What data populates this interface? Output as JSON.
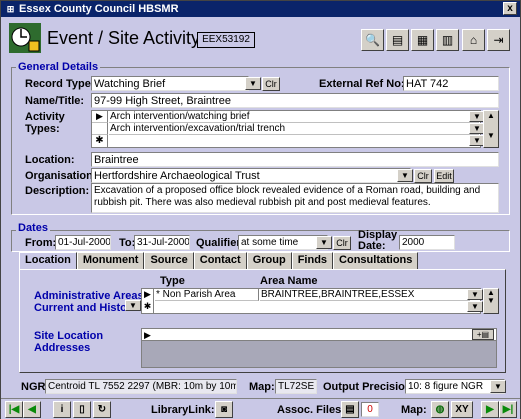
{
  "window": {
    "title": "Essex County Council HBSMR",
    "close": "x"
  },
  "header": {
    "form_title": "Event / Site Activity",
    "record_id": "EEX53192"
  },
  "general": {
    "legend": "General Details",
    "record_type_label": "Record Type:",
    "record_type_value": "Watching Brief",
    "ext_ref_label": "External Ref No:",
    "ext_ref_value": "HAT 742",
    "name_label": "Name/Title:",
    "name_value": "97-99 High Street, Braintree",
    "activity_label": "Activity Types:",
    "activity_types": [
      "Arch intervention/watching brief",
      "Arch intervention/excavation/trial trench"
    ],
    "location_label": "Location:",
    "location_value": "Braintree",
    "org_label": "Organisation:",
    "org_value": "Hertfordshire Archaeological Trust",
    "desc_label": "Description:",
    "desc_value": "Excavation of a proposed office block revealed evidence of a Roman road, building and rubbish pit. There was also medieval rubbish pit and post medieval features.",
    "clr": "Clr",
    "edit": "Edit"
  },
  "dates": {
    "legend": "Dates",
    "from_label": "From:",
    "from_value": "01-Jul-2000",
    "to_label": "To:",
    "to_value": "31-Jul-2000",
    "qualifier_label": "Qualifier:",
    "qualifier_value": "at some time",
    "display_label": "Display Date:",
    "display_value": "2000",
    "clr": "Clr"
  },
  "tabs": [
    "Location",
    "Monument",
    "Source",
    "Contact",
    "Group",
    "Finds",
    "Consultations"
  ],
  "location_tab": {
    "admin_label": "Administrative Areas - Current and Historic",
    "type_header": "Type",
    "area_header": "Area Name",
    "type_value": "Non Parish Area",
    "area_value": "BRAINTREE,BRAINTREE,ESSEX",
    "site_label": "Site Location Addresses"
  },
  "status": {
    "ngr_label": "NGR:",
    "ngr_value": "Centroid TL 7552 2297 (MBR: 10m by 10m)",
    "map_label": "Map:",
    "map_value": "TL72SE",
    "precision_label": "Output Precision:",
    "precision_value": "10: 8 figure NGR"
  },
  "navbar": {
    "library_label": "LibraryLink:",
    "assoc_label": "Assoc. Files:",
    "assoc_count": "0",
    "map_label": "Map:",
    "xy": "XY"
  }
}
